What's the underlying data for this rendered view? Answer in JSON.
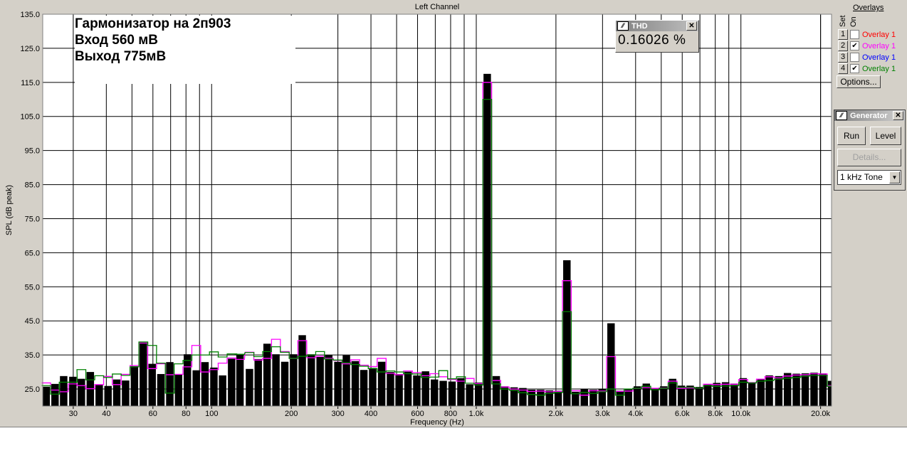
{
  "window": {
    "title": "Left Channel"
  },
  "annotation": {
    "lines": [
      "Гармонизатор на 2п903",
      "Вход 560 мВ",
      "Выход 775мВ"
    ]
  },
  "thd": {
    "title": "THD",
    "value": "0.16026 %"
  },
  "overlays": {
    "title": "Overlays",
    "set_label": "Set",
    "on_label": "On",
    "items": [
      {
        "num": "1",
        "label": "Overlay 1",
        "checked": false,
        "color": "#ff0000"
      },
      {
        "num": "2",
        "label": "Overlay 1",
        "checked": true,
        "color": "#ff00ff"
      },
      {
        "num": "3",
        "label": "Overlay 1",
        "checked": false,
        "color": "#0000ff"
      },
      {
        "num": "4",
        "label": "Overlay 1",
        "checked": true,
        "color": "#008000"
      }
    ],
    "options_label": "Options..."
  },
  "generator": {
    "title": "Generator",
    "run_label": "Run",
    "level_label": "Level",
    "details_label": "Details...",
    "tone_value": "1 kHz Tone"
  },
  "chart_data": {
    "type": "bar",
    "xlabel": "Frequency (Hz)",
    "ylabel": "SPL (dB peak)",
    "xscale": "log",
    "xlim": [
      23,
      22000
    ],
    "ylim": [
      20,
      135
    ],
    "grid": true,
    "yticks": [
      "135.0",
      "125.0",
      "115.0",
      "105.0",
      "95.0",
      "85.0",
      "75.0",
      "65.0",
      "55.0",
      "45.0",
      "35.0",
      "25.0"
    ],
    "xtick_labels": [
      {
        "v": 30,
        "t": "30"
      },
      {
        "v": 40,
        "t": "40"
      },
      {
        "v": 60,
        "t": "60"
      },
      {
        "v": 80,
        "t": "80"
      },
      {
        "v": 100,
        "t": "100"
      },
      {
        "v": 200,
        "t": "200"
      },
      {
        "v": 300,
        "t": "300"
      },
      {
        "v": 400,
        "t": "400"
      },
      {
        "v": 600,
        "t": "600"
      },
      {
        "v": 800,
        "t": "800"
      },
      {
        "v": 1000,
        "t": "1.0k"
      },
      {
        "v": 2000,
        "t": "2.0k"
      },
      {
        "v": 3000,
        "t": "3.0k"
      },
      {
        "v": 4000,
        "t": "4.0k"
      },
      {
        "v": 6000,
        "t": "6.0k"
      },
      {
        "v": 8000,
        "t": "8.0k"
      },
      {
        "v": 10000,
        "t": "10.0k"
      },
      {
        "v": 20000,
        "t": "20.0k"
      }
    ],
    "x": [
      23.7,
      25.6,
      27.6,
      29.9,
      32.2,
      34.8,
      37.6,
      40.6,
      43.8,
      47.3,
      51.1,
      55.2,
      59.6,
      64.3,
      69.5,
      75.0,
      81.0,
      87.5,
      94.4,
      102,
      110,
      119,
      128,
      139,
      150,
      162,
      175,
      189,
      204,
      220,
      238,
      257,
      277,
      300,
      323,
      349,
      376,
      406,
      439,
      474,
      511,
      552,
      596,
      643,
      695,
      750,
      810,
      875,
      944,
      1020,
      1100,
      1190,
      1280,
      1390,
      1500,
      1620,
      1750,
      1890,
      2040,
      2200,
      2370,
      2560,
      2770,
      2990,
      3230,
      3490,
      3760,
      4060,
      4390,
      4740,
      5110,
      5520,
      5960,
      6430,
      6950,
      7500,
      8100,
      8750,
      9440,
      10200,
      11000,
      11900,
      12800,
      13900,
      15000,
      16200,
      17500,
      18900,
      20400,
      22000
    ],
    "series": [
      {
        "color": "#000000",
        "style": "filled",
        "values": [
          25.7,
          26.5,
          28.8,
          28.6,
          28.0,
          30.0,
          26.2,
          25.9,
          27.8,
          27.5,
          31.7,
          38.8,
          32.4,
          29.4,
          32.9,
          29.2,
          35.2,
          30.5,
          32.9,
          31.3,
          29.0,
          33.9,
          35.0,
          30.9,
          33.8,
          38.3,
          35.2,
          33.0,
          35.2,
          40.8,
          35.2,
          34.4,
          35.0,
          33.0,
          34.9,
          33.2,
          30.6,
          31.2,
          33.0,
          30.0,
          29.4,
          30.1,
          29.0,
          30.2,
          27.8,
          27.4,
          27.2,
          28.2,
          26.4,
          26.9,
          117.5,
          28.8,
          25.8,
          25.5,
          25.3,
          24.8,
          24.8,
          24.6,
          24.5,
          62.8,
          24.2,
          25.0,
          24.8,
          25.0,
          44.3,
          24.5,
          24.9,
          25.8,
          26.6,
          25.0,
          25.8,
          28.0,
          26.0,
          26.0,
          25.6,
          26.5,
          26.8,
          27.0,
          26.6,
          28.2,
          26.9,
          28.0,
          29.0,
          28.8,
          29.7,
          29.5,
          29.6,
          29.8,
          29.6,
          27.4
        ]
      },
      {
        "name": "Overlay 1",
        "color": "#ff00ff",
        "style": "outline",
        "values": [
          26.8,
          24.7,
          24.2,
          26.5,
          26.0,
          25.1,
          26.3,
          28.7,
          26.3,
          29.3,
          31.9,
          38.5,
          31.0,
          32.4,
          29.2,
          29.3,
          31.5,
          37.8,
          30.0,
          30.7,
          32.6,
          34.1,
          33.7,
          35.8,
          33.5,
          34.0,
          39.6,
          36.0,
          34.0,
          39.2,
          34.2,
          34.6,
          34.0,
          33.4,
          32.4,
          33.6,
          32.0,
          31.6,
          34.0,
          29.6,
          29.2,
          30.3,
          29.8,
          28.9,
          29.5,
          28.6,
          27.8,
          27.3,
          28.1,
          26.6,
          115.0,
          27.5,
          25.6,
          25.0,
          24.7,
          24.3,
          24.4,
          24.2,
          24.3,
          56.8,
          24.5,
          23.2,
          24.5,
          24.4,
          34.5,
          24.3,
          24.4,
          25.2,
          25.4,
          25.2,
          25.3,
          27.3,
          25.2,
          25.3,
          25.3,
          26.4,
          26.3,
          26.4,
          26.4,
          27.8,
          26.9,
          27.9,
          28.6,
          28.3,
          28.8,
          29.1,
          29.2,
          29.5,
          29.4,
          26.0
        ]
      },
      {
        "name": "Overlay 1",
        "color": "#008000",
        "style": "outline",
        "values": [
          26.0,
          23.5,
          27.0,
          27.0,
          30.7,
          27.7,
          28.9,
          28.4,
          29.4,
          29.0,
          31.5,
          38.8,
          37.8,
          32.6,
          23.8,
          32.4,
          33.4,
          35.0,
          35.0,
          35.9,
          34.4,
          35.3,
          35.2,
          35.7,
          34.5,
          36.0,
          37.4,
          35.8,
          34.0,
          34.6,
          35.0,
          36.0,
          33.8,
          33.5,
          32.7,
          32.2,
          31.7,
          31.0,
          30.0,
          30.3,
          30.0,
          29.5,
          29.4,
          28.4,
          28.5,
          30.4,
          28.0,
          28.6,
          26.7,
          26.2,
          110.0,
          26.5,
          25.0,
          24.6,
          23.9,
          23.4,
          23.2,
          23.7,
          24.0,
          47.7,
          23.6,
          24.0,
          23.7,
          24.2,
          25.0,
          23.2,
          25.0,
          25.2,
          25.8,
          24.8,
          25.2,
          26.8,
          25.5,
          25.5,
          25.3,
          26.0,
          25.8,
          25.9,
          26.0,
          27.0,
          26.8,
          27.3,
          27.5,
          27.9,
          28.2,
          28.4,
          28.8,
          29.0,
          29.0,
          25.8
        ]
      }
    ]
  }
}
